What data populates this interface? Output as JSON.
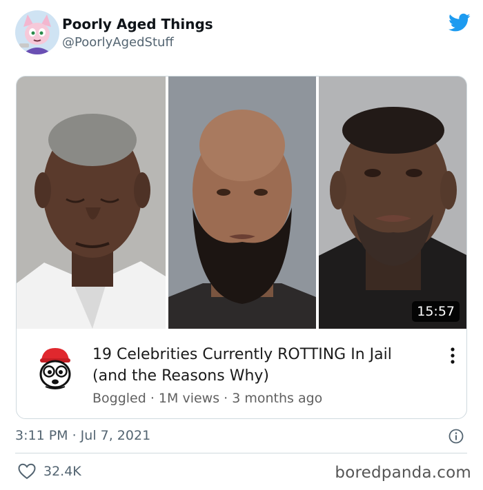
{
  "author": {
    "name": "Poorly Aged Things",
    "handle": "@PoorlyAgedStuff"
  },
  "icons": {
    "avatar": "cartoon-character-avatar",
    "brand": "twitter-bird-icon",
    "channel": "boggled-mascot-icon",
    "menu": "more-vertical-icon",
    "info": "info-icon",
    "like": "heart-icon"
  },
  "video": {
    "duration": "15:57",
    "title": "19 Celebrities Currently ROTTING In Jail (and the Reasons Why)",
    "meta": "Boggled · 1M views · 3 months ago"
  },
  "tweet": {
    "timestamp": "3:11 PM · Jul 7, 2021",
    "likes": "32.4K"
  },
  "watermark": "boredpanda.com",
  "colors": {
    "twitter_blue": "#1d9bf0",
    "secondary_text": "#536471",
    "border": "#cfd9de"
  }
}
